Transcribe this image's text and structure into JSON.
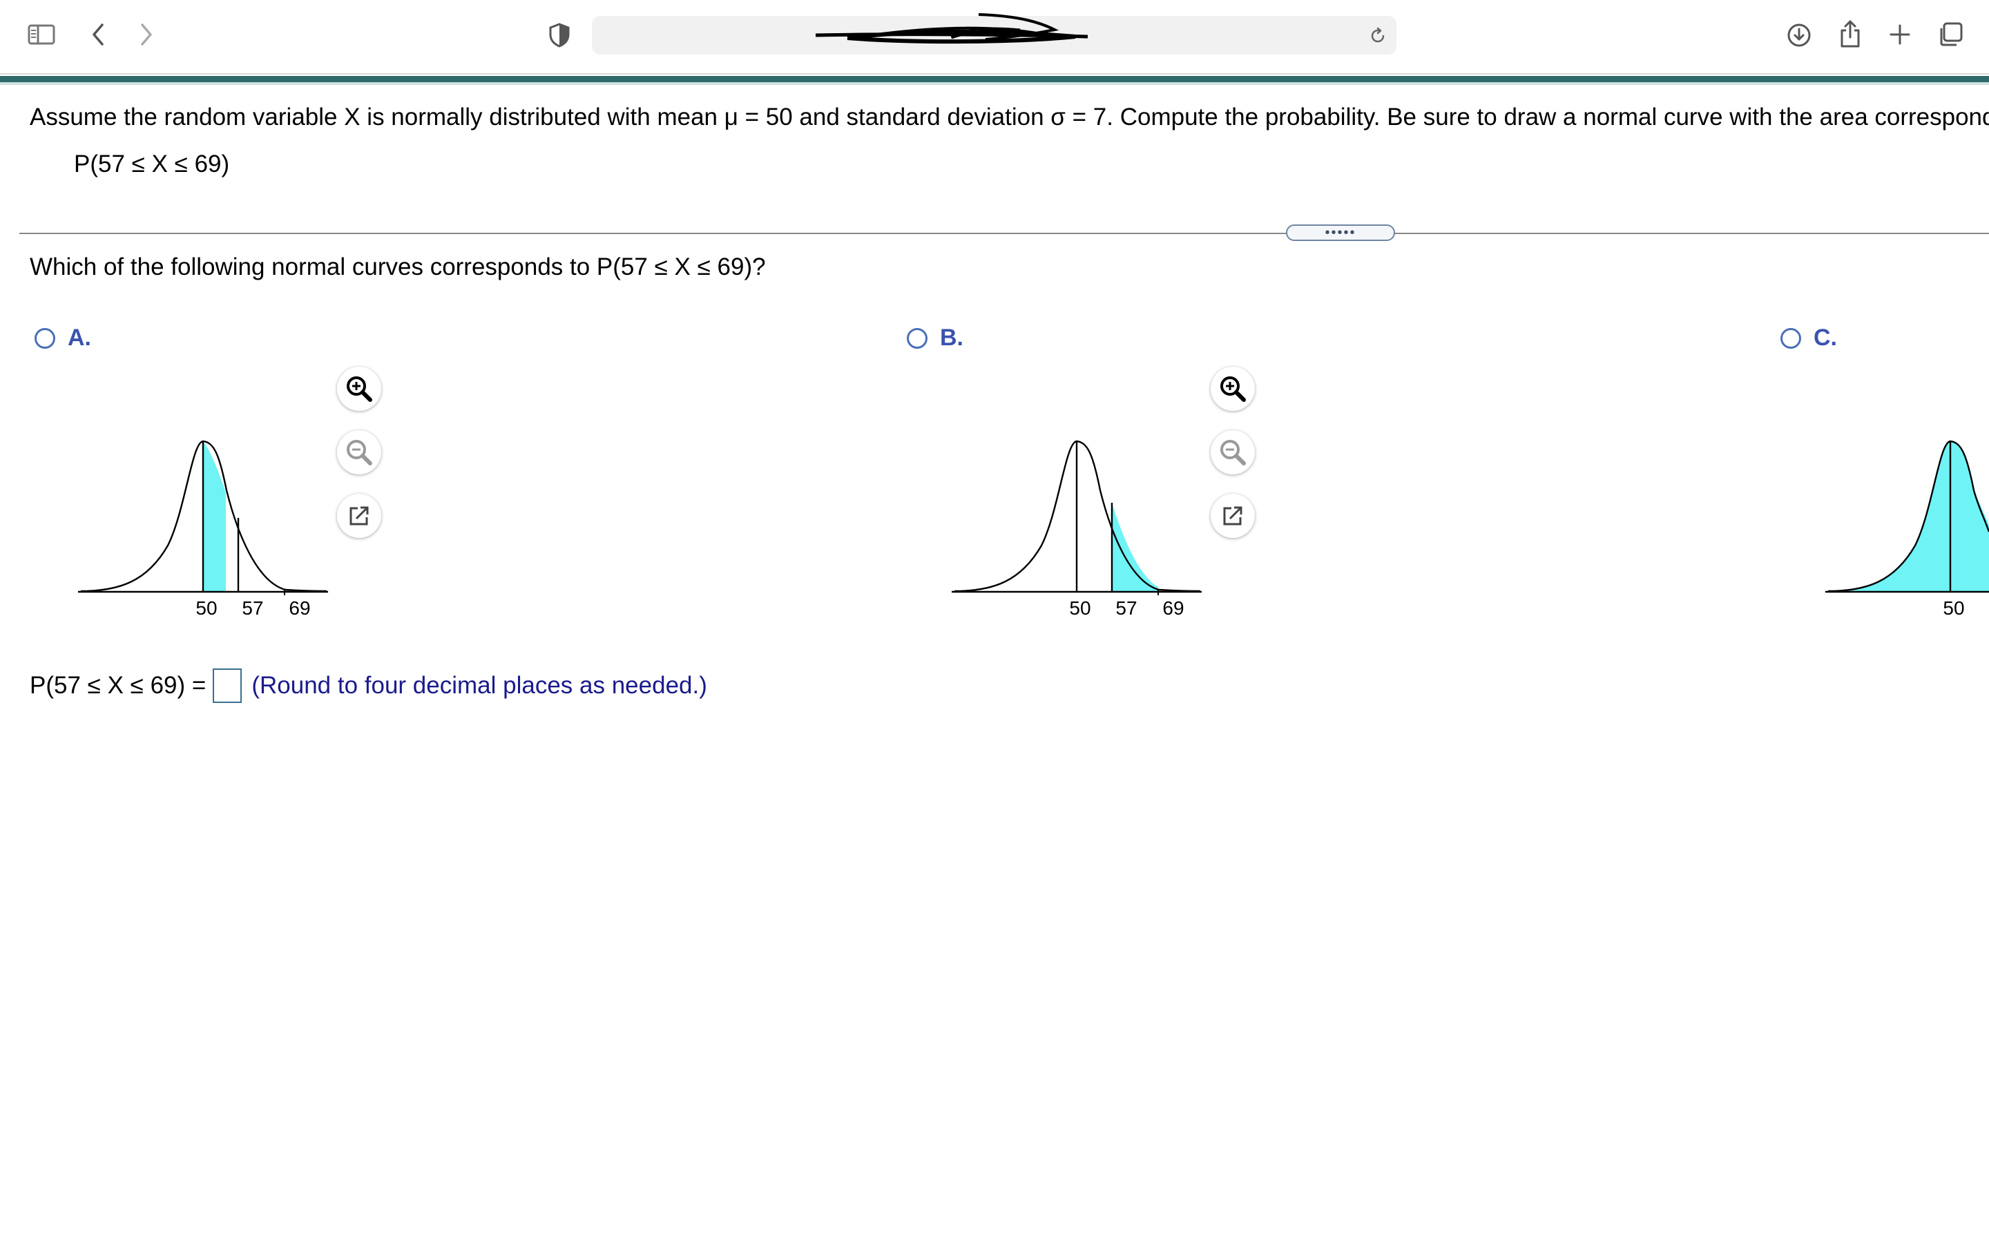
{
  "browser": {
    "address_text": "",
    "icons": [
      "sidebar-icon",
      "back-icon",
      "forward-icon",
      "shield-icon",
      "reload-icon",
      "download-icon",
      "share-icon",
      "new-tab-icon",
      "tabs-overview-icon"
    ]
  },
  "question": {
    "statement": "Assume the random variable X is normally distributed with mean μ = 50 and standard deviation σ = 7. Compute the probability. Be sure to draw a normal curve with the area correspond",
    "expression": "P(57 ≤ X ≤ 69)",
    "splitter": "•••••",
    "prompt": "Which of the following normal curves corresponds to P(57 ≤ X ≤ 69)?"
  },
  "options": [
    {
      "letter": "A.",
      "tick_labels": [
        "50",
        "57",
        "69"
      ],
      "shaded": "from 50 to 57",
      "icons": [
        "zoom-in-icon",
        "zoom-out-icon",
        "open-external-icon"
      ]
    },
    {
      "letter": "B.",
      "tick_labels": [
        "50",
        "57",
        "69"
      ],
      "shaded": "from 57 to 69",
      "icons": [
        "zoom-in-icon",
        "zoom-out-icon",
        "open-external-icon"
      ]
    },
    {
      "letter": "C.",
      "tick_labels": [
        "50"
      ],
      "shaded": "from left tail to beyond 50"
    }
  ],
  "answer": {
    "label": "P(57 ≤ X ≤ 69) =",
    "value": "",
    "hint": "(Round to four decimal places as needed.)"
  },
  "colors": {
    "shade": "#6ff3f5",
    "accent_teal": "#2e6a6a",
    "radio_blue": "#4a6fb8",
    "hint_blue": "#1a1a8c"
  }
}
